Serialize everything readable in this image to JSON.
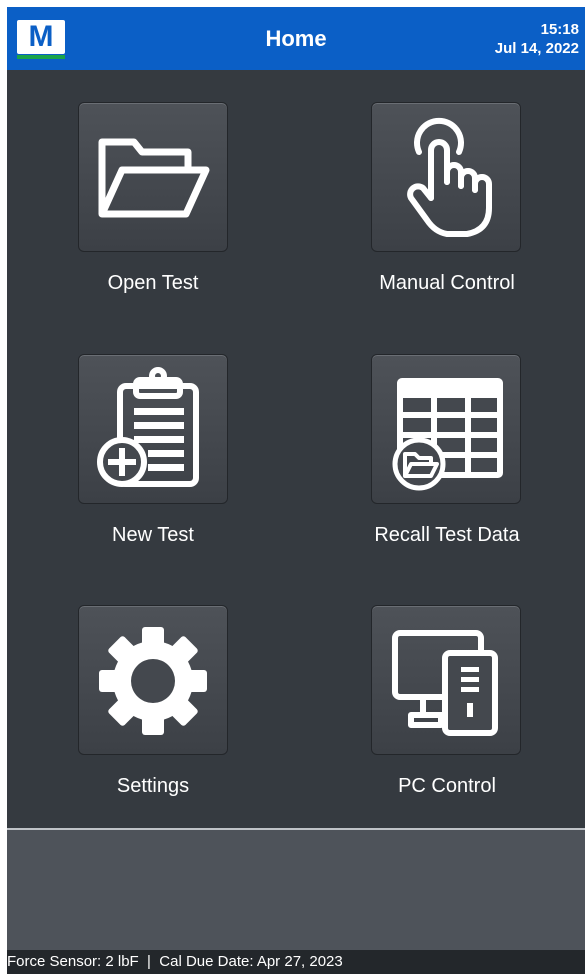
{
  "header": {
    "logo_letter": "M",
    "title": "Home",
    "time": "15:18",
    "date": "Jul 14, 2022"
  },
  "tiles": [
    {
      "label": "Open Test",
      "icon": "folder-open-icon"
    },
    {
      "label": "Manual Control",
      "icon": "hand-pointer-icon"
    },
    {
      "label": "New Test",
      "icon": "clipboard-add-icon"
    },
    {
      "label": "Recall Test Data",
      "icon": "table-folder-icon"
    },
    {
      "label": "Settings",
      "icon": "gear-icon"
    },
    {
      "label": "PC Control",
      "icon": "computer-icon"
    }
  ],
  "status": {
    "text": "Force Sensor: 2 lbF  |  Cal Due Date: Apr 27, 2023"
  },
  "colors": {
    "header_blue": "#0b5fc6",
    "panel": "#353a40",
    "accent_green": "#1aa34a"
  }
}
